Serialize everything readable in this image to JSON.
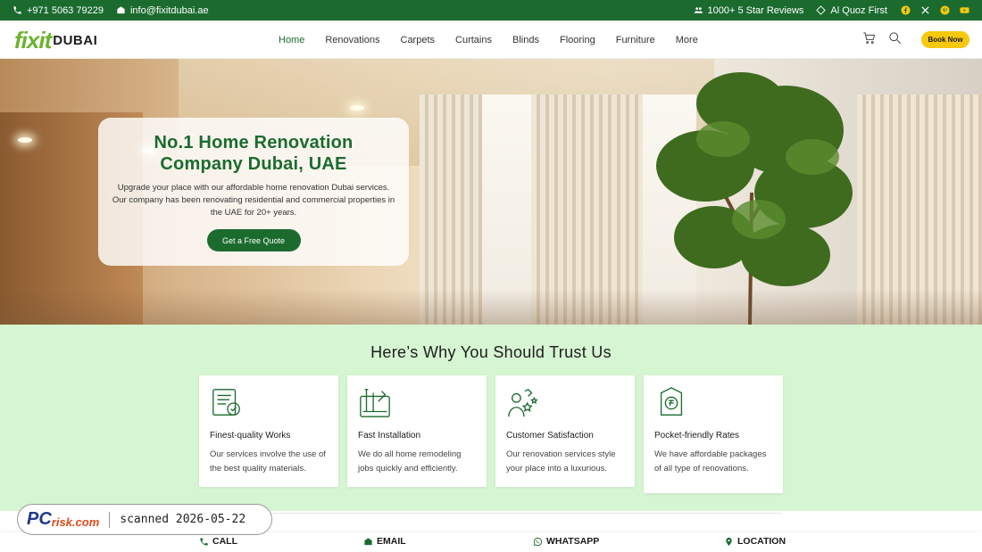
{
  "topbar": {
    "phone": "+971 5063 79229",
    "email": "info@fixitdubai.ae",
    "reviews": "1000+ 5 Star Reviews",
    "location": "Al Quoz First",
    "social_icons": [
      "facebook-icon",
      "x-icon",
      "pinterest-icon",
      "youtube-icon"
    ]
  },
  "header": {
    "logo_fixit": "fixit",
    "logo_dubai": "DUBAI",
    "nav": [
      "Home",
      "Renovations",
      "Carpets",
      "Curtains",
      "Blinds",
      "Flooring",
      "Furniture",
      "More"
    ],
    "active_nav": "Home",
    "book_label": "Book Now"
  },
  "hero": {
    "title": "No.1 Home Renovation Company Dubai, UAE",
    "description": "Upgrade your place with our affordable home renovation Dubai services. Our company has been renovating residential and commercial properties in the UAE for 20+ years.",
    "cta": "Get a Free Quote"
  },
  "trust": {
    "heading": "Here’s Why You Should Trust Us",
    "cards": [
      {
        "icon": "quality-certificate-icon",
        "title": "Finest-quality Works",
        "desc": "Our services involve the use of the best quality materials."
      },
      {
        "icon": "installation-tools-icon",
        "title": "Fast Installation",
        "desc": "We do all home remodeling jobs quickly and efficiently."
      },
      {
        "icon": "customer-rating-icon",
        "title": "Customer Satisfaction",
        "desc": "Our renovation services style your place into a luxurious."
      },
      {
        "icon": "price-tag-icon",
        "title": "Pocket-friendly Rates",
        "desc": "We have affordable packages of all type of renovations."
      }
    ]
  },
  "bottombar": {
    "call": "CALL",
    "email": "EMAIL",
    "whatsapp": "WHATSAPP",
    "location": "LOCATION"
  },
  "watermark": {
    "logo_pc": "PC",
    "logo_risk": "risk.com",
    "scanned": "scanned 2026-05-22"
  },
  "colors": {
    "brand_green": "#1b6b2f",
    "accent_yellow": "#f6c90e",
    "trust_bg": "#d6f5d2"
  }
}
